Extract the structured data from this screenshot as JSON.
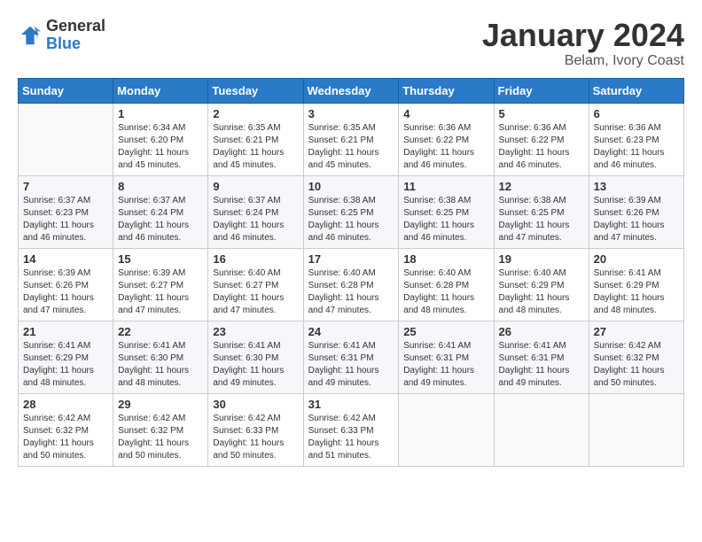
{
  "header": {
    "logo_general": "General",
    "logo_blue": "Blue",
    "month_title": "January 2024",
    "location": "Belam, Ivory Coast"
  },
  "weekdays": [
    "Sunday",
    "Monday",
    "Tuesday",
    "Wednesday",
    "Thursday",
    "Friday",
    "Saturday"
  ],
  "weeks": [
    [
      {
        "day": "",
        "sunrise": "",
        "sunset": "",
        "daylight": ""
      },
      {
        "day": "1",
        "sunrise": "Sunrise: 6:34 AM",
        "sunset": "Sunset: 6:20 PM",
        "daylight": "Daylight: 11 hours and 45 minutes."
      },
      {
        "day": "2",
        "sunrise": "Sunrise: 6:35 AM",
        "sunset": "Sunset: 6:21 PM",
        "daylight": "Daylight: 11 hours and 45 minutes."
      },
      {
        "day": "3",
        "sunrise": "Sunrise: 6:35 AM",
        "sunset": "Sunset: 6:21 PM",
        "daylight": "Daylight: 11 hours and 45 minutes."
      },
      {
        "day": "4",
        "sunrise": "Sunrise: 6:36 AM",
        "sunset": "Sunset: 6:22 PM",
        "daylight": "Daylight: 11 hours and 46 minutes."
      },
      {
        "day": "5",
        "sunrise": "Sunrise: 6:36 AM",
        "sunset": "Sunset: 6:22 PM",
        "daylight": "Daylight: 11 hours and 46 minutes."
      },
      {
        "day": "6",
        "sunrise": "Sunrise: 6:36 AM",
        "sunset": "Sunset: 6:23 PM",
        "daylight": "Daylight: 11 hours and 46 minutes."
      }
    ],
    [
      {
        "day": "7",
        "sunrise": "Sunrise: 6:37 AM",
        "sunset": "Sunset: 6:23 PM",
        "daylight": "Daylight: 11 hours and 46 minutes."
      },
      {
        "day": "8",
        "sunrise": "Sunrise: 6:37 AM",
        "sunset": "Sunset: 6:24 PM",
        "daylight": "Daylight: 11 hours and 46 minutes."
      },
      {
        "day": "9",
        "sunrise": "Sunrise: 6:37 AM",
        "sunset": "Sunset: 6:24 PM",
        "daylight": "Daylight: 11 hours and 46 minutes."
      },
      {
        "day": "10",
        "sunrise": "Sunrise: 6:38 AM",
        "sunset": "Sunset: 6:25 PM",
        "daylight": "Daylight: 11 hours and 46 minutes."
      },
      {
        "day": "11",
        "sunrise": "Sunrise: 6:38 AM",
        "sunset": "Sunset: 6:25 PM",
        "daylight": "Daylight: 11 hours and 46 minutes."
      },
      {
        "day": "12",
        "sunrise": "Sunrise: 6:38 AM",
        "sunset": "Sunset: 6:25 PM",
        "daylight": "Daylight: 11 hours and 47 minutes."
      },
      {
        "day": "13",
        "sunrise": "Sunrise: 6:39 AM",
        "sunset": "Sunset: 6:26 PM",
        "daylight": "Daylight: 11 hours and 47 minutes."
      }
    ],
    [
      {
        "day": "14",
        "sunrise": "Sunrise: 6:39 AM",
        "sunset": "Sunset: 6:26 PM",
        "daylight": "Daylight: 11 hours and 47 minutes."
      },
      {
        "day": "15",
        "sunrise": "Sunrise: 6:39 AM",
        "sunset": "Sunset: 6:27 PM",
        "daylight": "Daylight: 11 hours and 47 minutes."
      },
      {
        "day": "16",
        "sunrise": "Sunrise: 6:40 AM",
        "sunset": "Sunset: 6:27 PM",
        "daylight": "Daylight: 11 hours and 47 minutes."
      },
      {
        "day": "17",
        "sunrise": "Sunrise: 6:40 AM",
        "sunset": "Sunset: 6:28 PM",
        "daylight": "Daylight: 11 hours and 47 minutes."
      },
      {
        "day": "18",
        "sunrise": "Sunrise: 6:40 AM",
        "sunset": "Sunset: 6:28 PM",
        "daylight": "Daylight: 11 hours and 48 minutes."
      },
      {
        "day": "19",
        "sunrise": "Sunrise: 6:40 AM",
        "sunset": "Sunset: 6:29 PM",
        "daylight": "Daylight: 11 hours and 48 minutes."
      },
      {
        "day": "20",
        "sunrise": "Sunrise: 6:41 AM",
        "sunset": "Sunset: 6:29 PM",
        "daylight": "Daylight: 11 hours and 48 minutes."
      }
    ],
    [
      {
        "day": "21",
        "sunrise": "Sunrise: 6:41 AM",
        "sunset": "Sunset: 6:29 PM",
        "daylight": "Daylight: 11 hours and 48 minutes."
      },
      {
        "day": "22",
        "sunrise": "Sunrise: 6:41 AM",
        "sunset": "Sunset: 6:30 PM",
        "daylight": "Daylight: 11 hours and 48 minutes."
      },
      {
        "day": "23",
        "sunrise": "Sunrise: 6:41 AM",
        "sunset": "Sunset: 6:30 PM",
        "daylight": "Daylight: 11 hours and 49 minutes."
      },
      {
        "day": "24",
        "sunrise": "Sunrise: 6:41 AM",
        "sunset": "Sunset: 6:31 PM",
        "daylight": "Daylight: 11 hours and 49 minutes."
      },
      {
        "day": "25",
        "sunrise": "Sunrise: 6:41 AM",
        "sunset": "Sunset: 6:31 PM",
        "daylight": "Daylight: 11 hours and 49 minutes."
      },
      {
        "day": "26",
        "sunrise": "Sunrise: 6:41 AM",
        "sunset": "Sunset: 6:31 PM",
        "daylight": "Daylight: 11 hours and 49 minutes."
      },
      {
        "day": "27",
        "sunrise": "Sunrise: 6:42 AM",
        "sunset": "Sunset: 6:32 PM",
        "daylight": "Daylight: 11 hours and 50 minutes."
      }
    ],
    [
      {
        "day": "28",
        "sunrise": "Sunrise: 6:42 AM",
        "sunset": "Sunset: 6:32 PM",
        "daylight": "Daylight: 11 hours and 50 minutes."
      },
      {
        "day": "29",
        "sunrise": "Sunrise: 6:42 AM",
        "sunset": "Sunset: 6:32 PM",
        "daylight": "Daylight: 11 hours and 50 minutes."
      },
      {
        "day": "30",
        "sunrise": "Sunrise: 6:42 AM",
        "sunset": "Sunset: 6:33 PM",
        "daylight": "Daylight: 11 hours and 50 minutes."
      },
      {
        "day": "31",
        "sunrise": "Sunrise: 6:42 AM",
        "sunset": "Sunset: 6:33 PM",
        "daylight": "Daylight: 11 hours and 51 minutes."
      },
      {
        "day": "",
        "sunrise": "",
        "sunset": "",
        "daylight": ""
      },
      {
        "day": "",
        "sunrise": "",
        "sunset": "",
        "daylight": ""
      },
      {
        "day": "",
        "sunrise": "",
        "sunset": "",
        "daylight": ""
      }
    ]
  ]
}
